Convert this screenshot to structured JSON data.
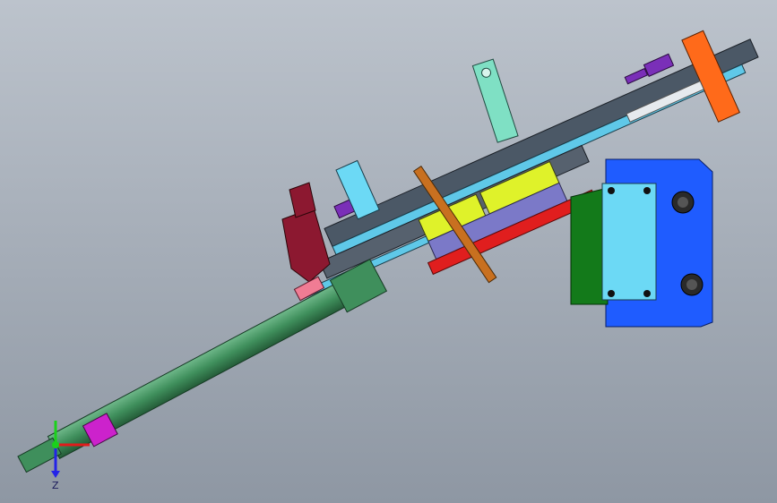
{
  "viewport": {
    "background_top": "#bcc3cc",
    "background_bottom": "#8e97a3"
  },
  "triad": {
    "z_label": "Z",
    "x_color": "#e01c1c",
    "y_color": "#1bd11b",
    "z_color": "#2323e8"
  },
  "colors": {
    "cylinder": "#3f8f5c",
    "cylinder_dark": "#2b6a42",
    "rail_dark": "#4b5866",
    "rail_light": "#5fc8e8",
    "orange": "#ff6a1a",
    "purple": "#7a2fb8",
    "magenta": "#cc22cc",
    "yellow": "#dff22a",
    "red": "#e01e1e",
    "maroon": "#8c1830",
    "blue": "#1f5cff",
    "green_plate": "#137a1a",
    "cyan_plate": "#6cd9f5",
    "pink": "#f07c94",
    "brown": "#c87020",
    "mint": "#7fe0c4"
  }
}
